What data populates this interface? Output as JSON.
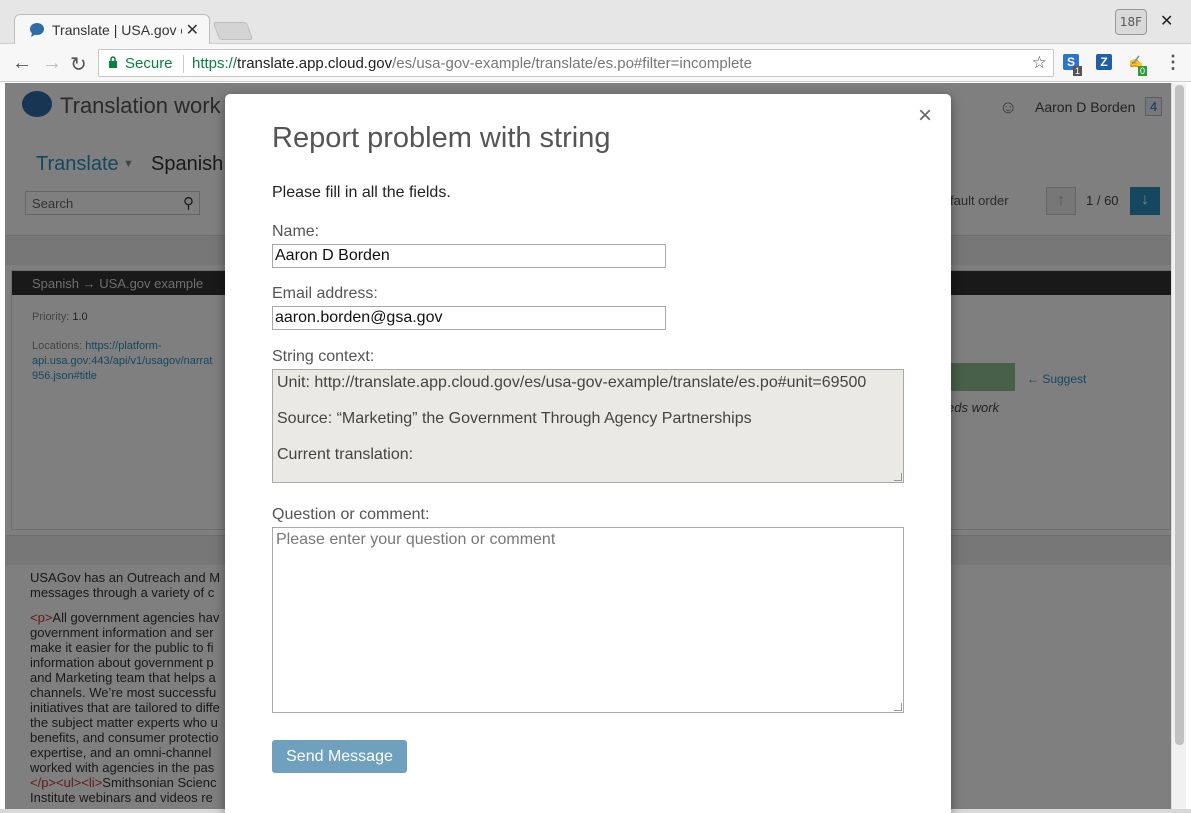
{
  "browser": {
    "tab_title": "Translate | USA.gov example",
    "profile_badge": "18F",
    "secure_label": "Secure",
    "url_scheme": "https://",
    "url_host": "translate.app.cloud.gov",
    "url_path": "/es/usa-gov-example/translate/es.po#filter=incomplete",
    "ext_badge_1": "1",
    "ext_badge_2": "0",
    "ext1_letter": "S",
    "ext2_letter": "Z"
  },
  "page": {
    "app_title": "Translation work",
    "user_name": "Aaron D Borden",
    "user_count": "4",
    "tab_translate": "Translate",
    "language": "Spanish",
    "search_placeholder": "Search",
    "order": "fault order",
    "counter": "1 / 60",
    "breadcrumb_language": "Spanish",
    "breadcrumb_sep": "→",
    "breadcrumb_project": "USA.gov example",
    "priority_label": "Priority:",
    "priority_value": "1.0",
    "locations_label": "Locations:",
    "locations_value": "https://platform-api.usa.gov:443/api/v1/usagov/narrat 956.json#title",
    "suggest": "← Suggest",
    "needs_work": "eds work",
    "body_intro": "USAGov has an Outreach and M messages through a variety of c",
    "body_tag_p": "<p>",
    "body_text": "All government agencies hav government information and ser make it easier for the public to fi information about government p and Marketing team that helps a channels. We’re most successfu initiatives that are tailored to diffe the subject matter experts who u benefits, and consumer protectio expertise, and an omni-channel worked with agencies in the pas",
    "body_tag_end": "</p><ul><li>",
    "body_tail": "Smithsonian Scienc Institute webinars and videos re"
  },
  "modal": {
    "title": "Report problem with string",
    "intro": "Please fill in all the fields.",
    "name_label": "Name:",
    "name_value": "Aaron D Borden",
    "email_label": "Email address:",
    "email_value": "aaron.borden@gsa.gov",
    "context_label": "String context:",
    "context_unit": "Unit: http://translate.app.cloud.gov/es/usa-gov-example/translate/es.po#unit=69500",
    "context_source": "Source: “Marketing” the Government Through Agency Partnerships",
    "context_translation": "Current translation:",
    "comment_label": "Question or comment:",
    "comment_placeholder": "Please enter your question or comment",
    "send_button": "Send Message",
    "close_glyph": "×"
  },
  "colors": {
    "secure_green": "#0b8043",
    "link_blue": "#2a8fbd",
    "send_button_bg": "#6fa1bf",
    "overlay": "rgba(0,0,0,0.5)"
  }
}
